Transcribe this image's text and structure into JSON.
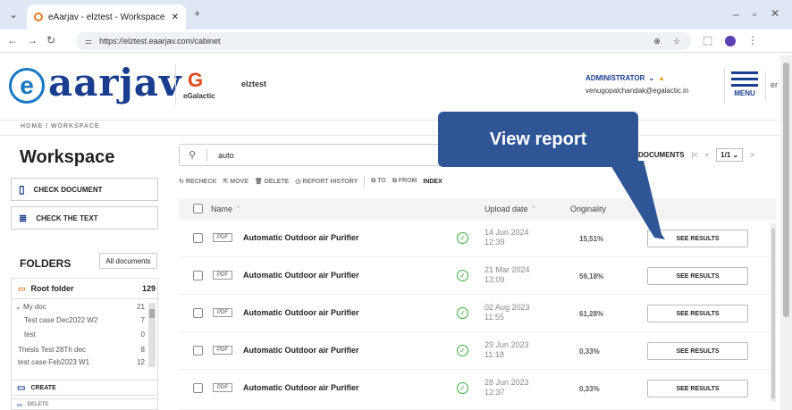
{
  "browser": {
    "tab_title": "eAarjav - elztest - Workspace",
    "url": "https://elztest.eaarjav.com/cabinet"
  },
  "header": {
    "brand": "aarjav",
    "partner_name": "eGalactic",
    "org": "elztest",
    "role": "ADMINISTRATOR",
    "email": "venugopalchandak@egalactic.in",
    "menu_label": "MENU",
    "lang_fragment": "er"
  },
  "breadcrumb": "HOME / WORKSPACE",
  "sidebar": {
    "title": "Workspace",
    "check_document": "CHECK DOCUMENT",
    "check_text": "CHECK THE TEXT",
    "folders_label": "FOLDERS",
    "all_documents": "All documents",
    "root_folder": "Root folder",
    "root_count": "129",
    "folders": [
      {
        "name": "My doc",
        "count": "21"
      },
      {
        "name": "Test case Dec2022 W2",
        "count": "7"
      },
      {
        "name": "test",
        "count": "0"
      },
      {
        "name": "Thesis Test 28Th dec",
        "count": "8"
      },
      {
        "name": "test case Feb2023 W1",
        "count": "12"
      }
    ],
    "create": "CREATE",
    "delete": "DELETE"
  },
  "search": {
    "value": "auto"
  },
  "actions": {
    "recheck": "RECHECK",
    "move": "MOVE",
    "delete": "DELETE",
    "report_history": "REPORT HISTORY",
    "to": "TO",
    "from": "FROM",
    "index": "INDEX"
  },
  "pager": {
    "documents": "DOCUMENTS",
    "page": "1/1"
  },
  "table": {
    "headers": {
      "name": "Name",
      "upload_date": "Upload date",
      "originality": "Originality"
    },
    "rows": [
      {
        "type": "PDF",
        "name": "Automatic Outdoor air Purifier",
        "date": "14 Jun 2024",
        "time": "12:39",
        "originality": "15,51%",
        "action": "SEE RESULTS"
      },
      {
        "type": "PDF",
        "name": "Automatic Outdoor air Purifier",
        "date": "21 Mar 2024",
        "time": "13:09",
        "originality": "59,18%",
        "action": "SEE RESULTS"
      },
      {
        "type": "PDF",
        "name": "Automatic Outdoor air Purifier",
        "date": "02 Aug 2023",
        "time": "11:55",
        "originality": "61,28%",
        "action": "SEE RESULTS"
      },
      {
        "type": "PDF",
        "name": "Automatic Outdoor air Purifier",
        "date": "29 Jun 2023",
        "time": "11:18",
        "originality": "0,33%",
        "action": "SEE RESULTS"
      },
      {
        "type": "PDF",
        "name": "Automatic Outdoor air Purifier",
        "date": "28 Jun 2023",
        "time": "12:37",
        "originality": "0,33%",
        "action": "SEE RESULTS"
      }
    ]
  },
  "callout": "View report",
  "colors": {
    "brand": "#1a3e8f",
    "callout": "#2f5597",
    "ok": "#3cab3c",
    "folder": "#e8782a"
  }
}
